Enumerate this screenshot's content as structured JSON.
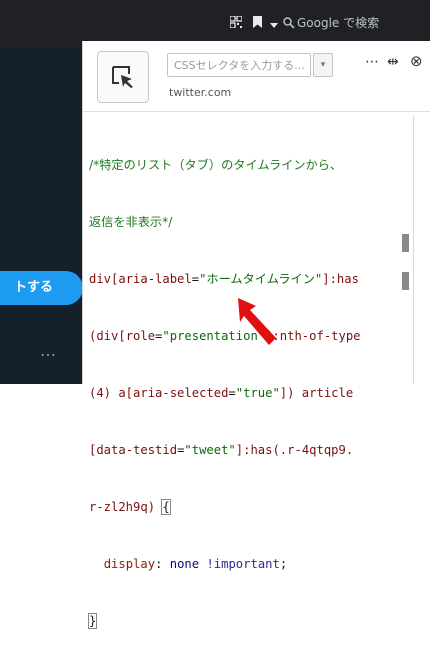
{
  "toolbar": {
    "search_placeholder": "Google で検索",
    "icons": [
      "qr-code-icon",
      "bookmark-icon",
      "chevron-down-icon",
      "search-icon"
    ]
  },
  "twitter": {
    "tweet_button_label": "トする",
    "more_label": "…"
  },
  "stylus_panel": {
    "selector_placeholder": "CSSセレクタを入力する...",
    "dropdown_glyph": "▾",
    "host": "twitter.com",
    "more_glyph": "⋯",
    "split_glyph": "⇹",
    "close_glyph": "⊗"
  },
  "code": {
    "comment_line1": "/*特定のリスト（タブ）のタイムラインから、",
    "comment_line2": "返信を非表示*/",
    "line3_a": "div[",
    "line3_attr": "aria-label",
    "line3_eq": "=",
    "line3_str": "\"ホームタイムライン\"",
    "line3_b": "]:has",
    "line4_a": "(div[",
    "line4_attr": "role",
    "line4_eq": "=",
    "line4_str": "\"presentation\"",
    "line4_b": "]:nth-of-type",
    "line5_a": "(4) a[",
    "line5_attr": "aria-selected",
    "line5_eq": "=",
    "line5_str": "\"true\"",
    "line5_b": "]) article",
    "line6_a": "[",
    "line6_attr": "data-testid",
    "line6_eq": "=",
    "line6_str": "\"tweet\"",
    "line6_b": "]:has(.r-4qtqp9.",
    "line7_a": "r-zl2h9q) ",
    "line7_brace": "{",
    "line8_prop": "display",
    "line8_colon": ": ",
    "line8_val": "none",
    "line8_space": " ",
    "line8_imp": "!important",
    "line8_semi": ";",
    "line9_brace": "}"
  },
  "colors": {
    "annotation_arrow": "#e01010",
    "twitter_blue": "#1d9bf0",
    "twitter_dark": "#15202b",
    "toolbar_dark": "#202124"
  }
}
